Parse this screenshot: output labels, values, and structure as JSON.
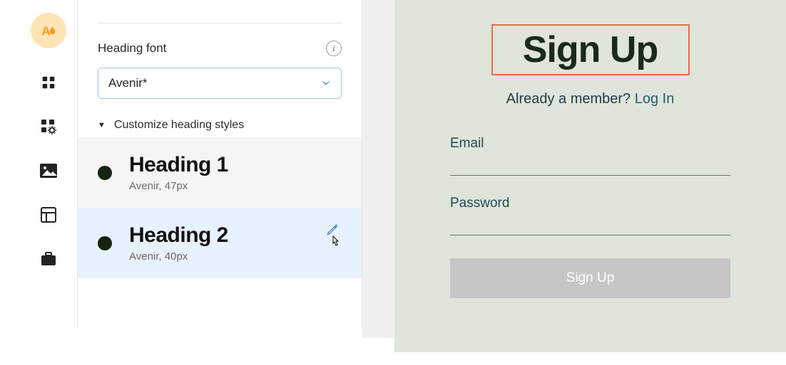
{
  "panel": {
    "heading_font_label": "Heading font",
    "font_value": "Avenir*",
    "customize_label": "Customize heading styles",
    "styles": [
      {
        "title": "Heading 1",
        "sub": "Avenir, 47px"
      },
      {
        "title": "Heading 2",
        "sub": "Avenir, 40px"
      }
    ]
  },
  "preview": {
    "title": "Sign Up",
    "member_text": "Already a member? ",
    "login_text": "Log In",
    "email_label": "Email",
    "password_label": "Password",
    "button_label": "Sign Up"
  }
}
